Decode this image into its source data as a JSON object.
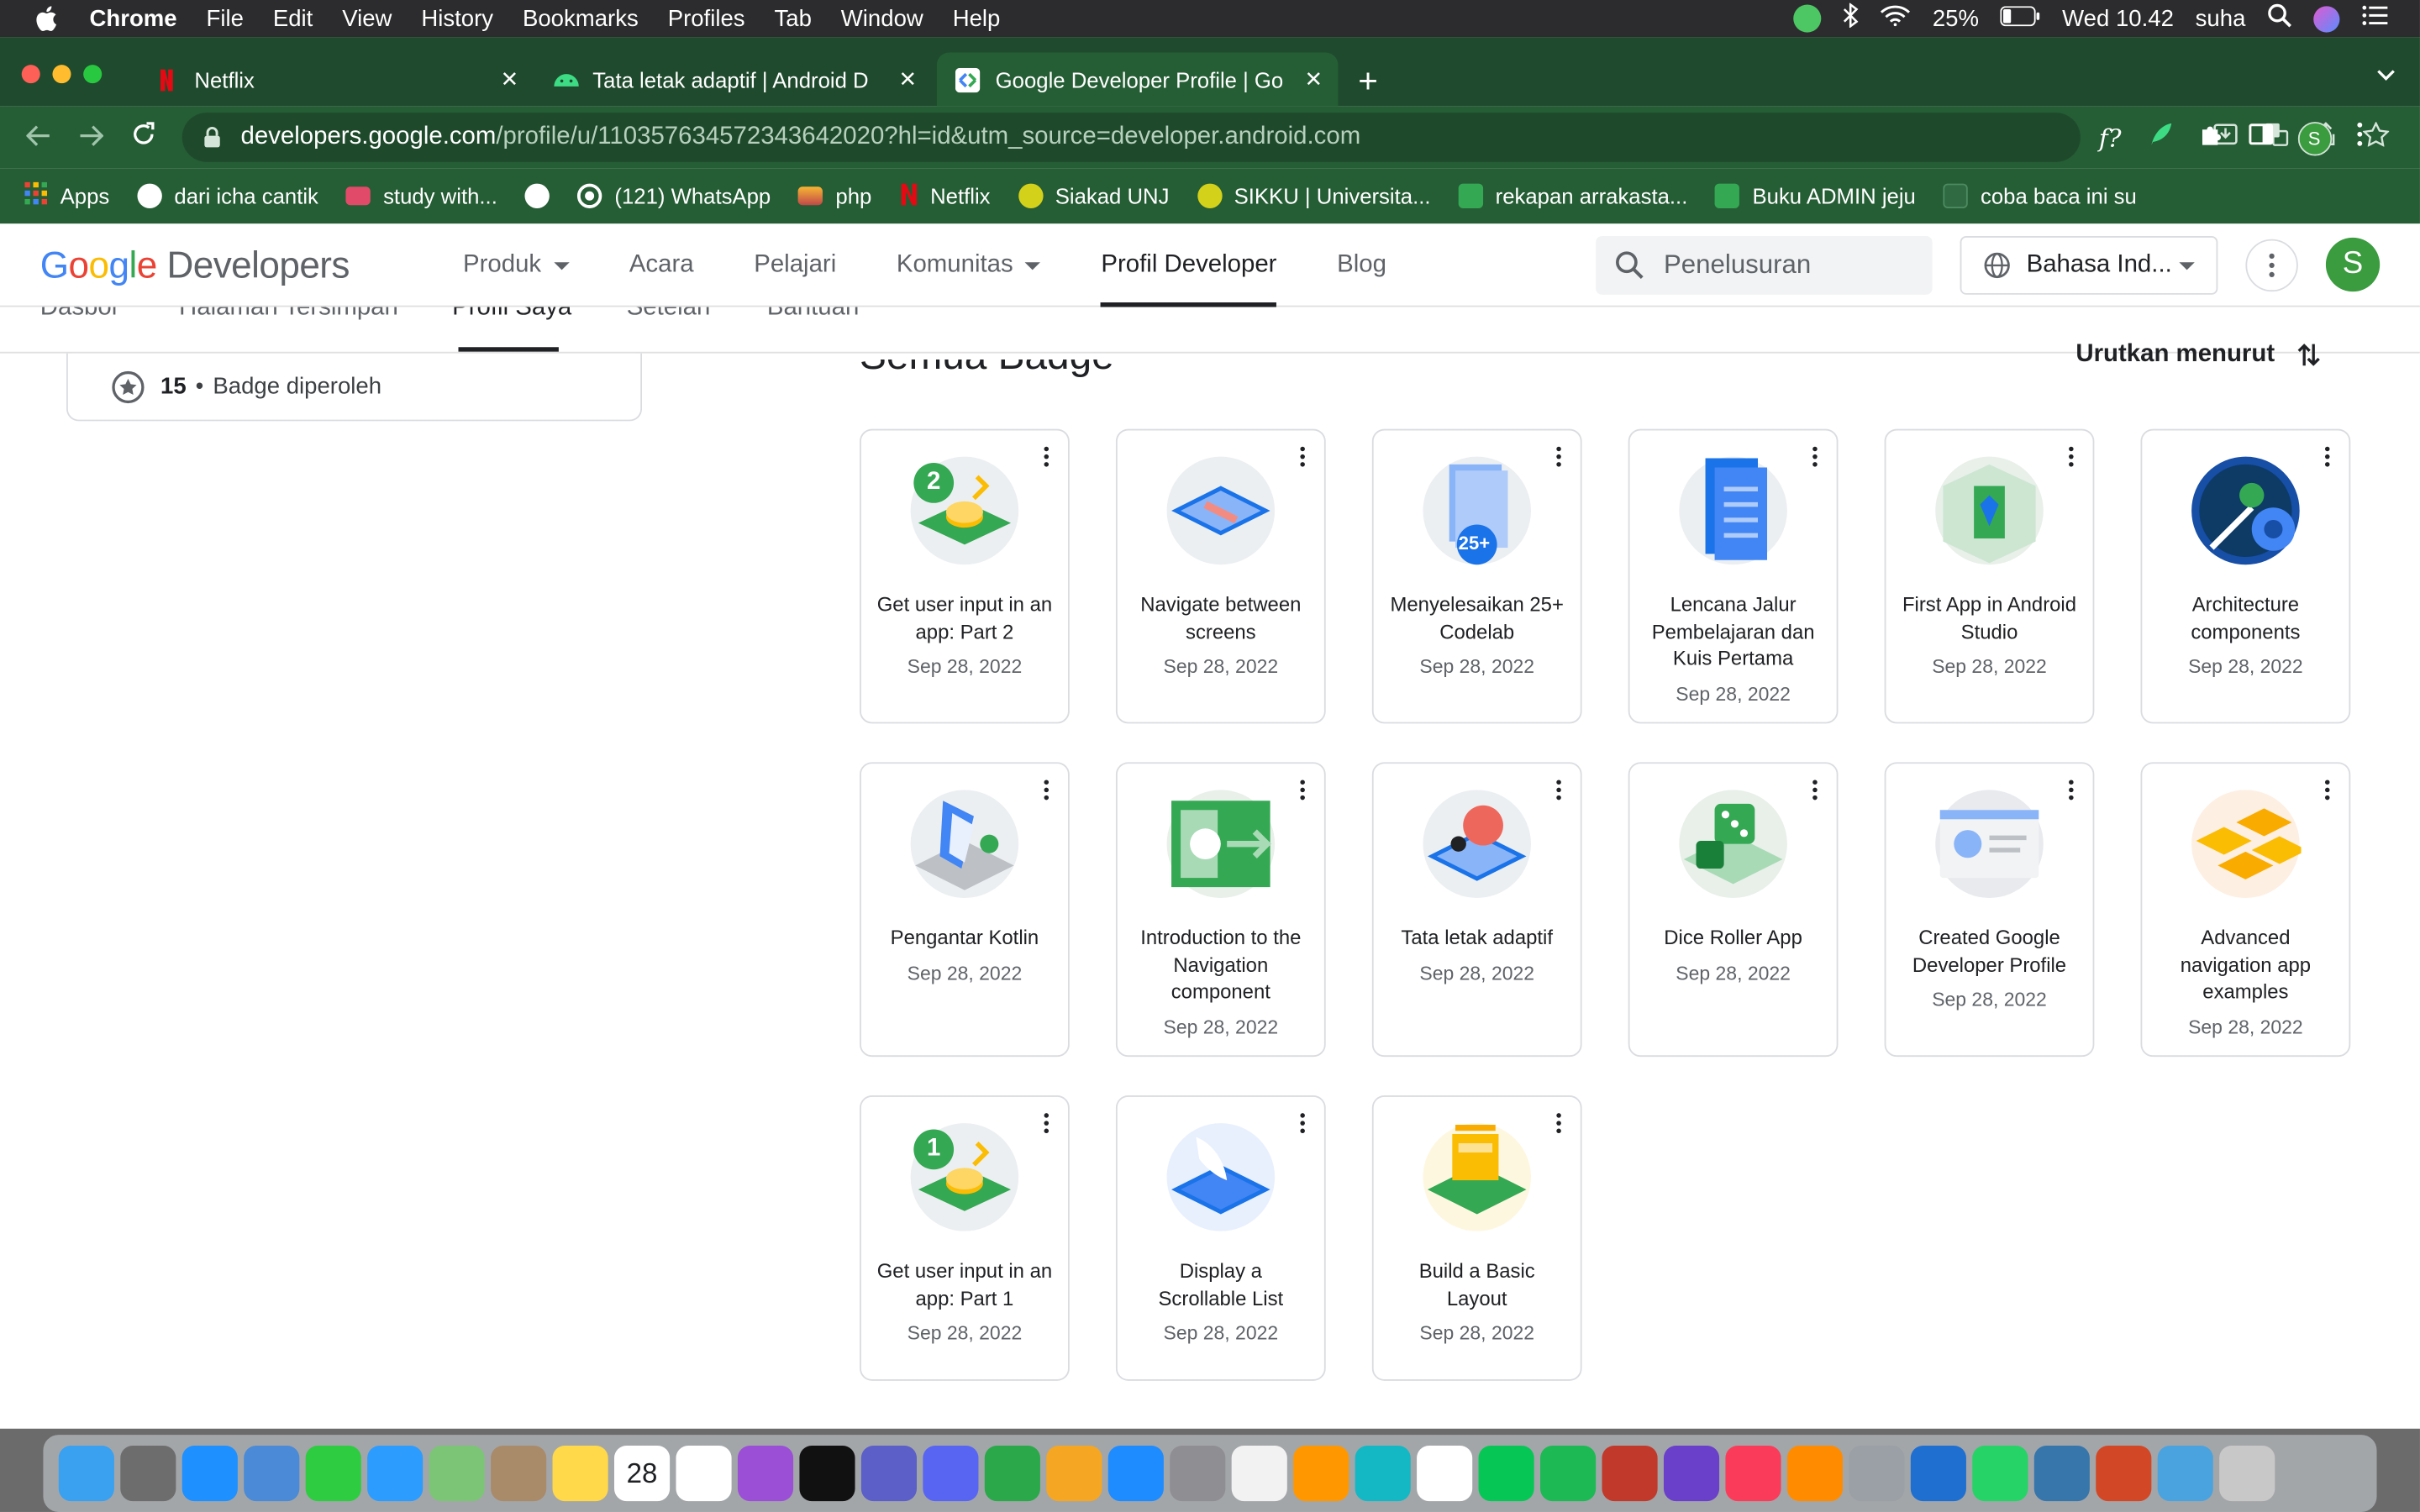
{
  "menubar": {
    "app": "Chrome",
    "items": [
      "File",
      "Edit",
      "View",
      "History",
      "Bookmarks",
      "Profiles",
      "Tab",
      "Window",
      "Help"
    ],
    "battery": "25%",
    "clock": "Wed 10.42",
    "user": "suha"
  },
  "tabs": [
    {
      "title": "Netflix"
    },
    {
      "title": "Tata letak adaptif  |  Android D"
    },
    {
      "title": "Google Developer Profile  |  Go"
    }
  ],
  "omnibox": {
    "host": "developers.google.com",
    "path": "/profile/u/110357634572343642020?hl=id&utm_source=developer.android.com"
  },
  "bookmarks": [
    {
      "label": "Apps"
    },
    {
      "label": "dari icha cantik"
    },
    {
      "label": "study with..."
    },
    {
      "label": ""
    },
    {
      "label": "(121) WhatsApp"
    },
    {
      "label": "php"
    },
    {
      "label": "Netflix"
    },
    {
      "label": "Siakad UNJ"
    },
    {
      "label": "SIKKU | Universita..."
    },
    {
      "label": "rekapan arrakasta..."
    },
    {
      "label": "Buku ADMIN jeju"
    },
    {
      "label": "coba baca ini su"
    }
  ],
  "header": {
    "logo_google": "Google",
    "logo_dev": "Developers",
    "nav": [
      {
        "label": "Produk",
        "dropdown": true
      },
      {
        "label": "Acara",
        "dropdown": false
      },
      {
        "label": "Pelajari",
        "dropdown": false
      },
      {
        "label": "Komunitas",
        "dropdown": true
      },
      {
        "label": "Profil Developer",
        "dropdown": false
      },
      {
        "label": "Blog",
        "dropdown": false
      }
    ],
    "search_placeholder": "Penelusuran",
    "language": "Bahasa Ind...",
    "avatar_initial": "S"
  },
  "subnav": [
    "Dasbor",
    "Halaman Tersimpan",
    "Profil Saya",
    "Setelan",
    "Bantuan"
  ],
  "summary": {
    "count": "15",
    "label": "Badge diperoleh"
  },
  "section": {
    "title": "Semua Badge",
    "sort_label": "Urutkan menurut"
  },
  "badges": [
    {
      "name": "Get user input in an app: Part 2",
      "date": "Sep 28, 2022",
      "art": "coins-2"
    },
    {
      "name": "Navigate between screens",
      "date": "Sep 28, 2022",
      "art": "navigate"
    },
    {
      "name": "Menyelesaikan 25+ Codelab",
      "date": "Sep 28, 2022",
      "art": "codelab-25"
    },
    {
      "name": "Lencana Jalur Pembelajaran dan Kuis Pertama",
      "date": "Sep 28, 2022",
      "art": "quiz"
    },
    {
      "name": "First App in Android Studio",
      "date": "Sep 28, 2022",
      "art": "first-app"
    },
    {
      "name": "Architecture components",
      "date": "Sep 28, 2022",
      "art": "architecture"
    },
    {
      "name": "Pengantar Kotlin",
      "date": "Sep 28, 2022",
      "art": "kotlin"
    },
    {
      "name": "Introduction to the Navigation component",
      "date": "Sep 28, 2022",
      "art": "nav-component"
    },
    {
      "name": "Tata letak adaptif",
      "date": "Sep 28, 2022",
      "art": "adaptive"
    },
    {
      "name": "Dice Roller App",
      "date": "Sep 28, 2022",
      "art": "dice"
    },
    {
      "name": "Created Google Developer Profile",
      "date": "Sep 28, 2022",
      "art": "profile"
    },
    {
      "name": "Advanced navigation app examples",
      "date": "Sep 28, 2022",
      "art": "advanced-nav"
    },
    {
      "name": "Get user input in an app: Part 1",
      "date": "Sep 28, 2022",
      "art": "coins-1"
    },
    {
      "name": "Display a Scrollable List",
      "date": "Sep 28, 2022",
      "art": "scroll-list"
    },
    {
      "name": "Build a Basic Layout",
      "date": "Sep 28, 2022",
      "art": "basic-layout"
    }
  ],
  "badge_labels": {
    "coins-2": "2",
    "coins-1": "1",
    "codelab-25": "25+"
  },
  "dock_apps": [
    "finder",
    "launchpad",
    "safari",
    "preview",
    "facetime",
    "messages",
    "maps",
    "contacts",
    "notes",
    "calendar",
    "reminders",
    "podcasts",
    "tv",
    "teams",
    "discord",
    "numbers",
    "pages",
    "app-store",
    "settings",
    "photos",
    "sublime",
    "canva",
    "chrome",
    "line",
    "spotify",
    "photobooth",
    "imovie",
    "music",
    "books",
    "utilities",
    "vscode",
    "whatsapp",
    "python",
    "powerpoint",
    "folder",
    "trash"
  ],
  "calendar_day": "28",
  "colors": {
    "chrome_tab_strip": "#1f4a2d",
    "chrome_toolbar": "#255d35",
    "google_green": "#3b9b3f"
  }
}
